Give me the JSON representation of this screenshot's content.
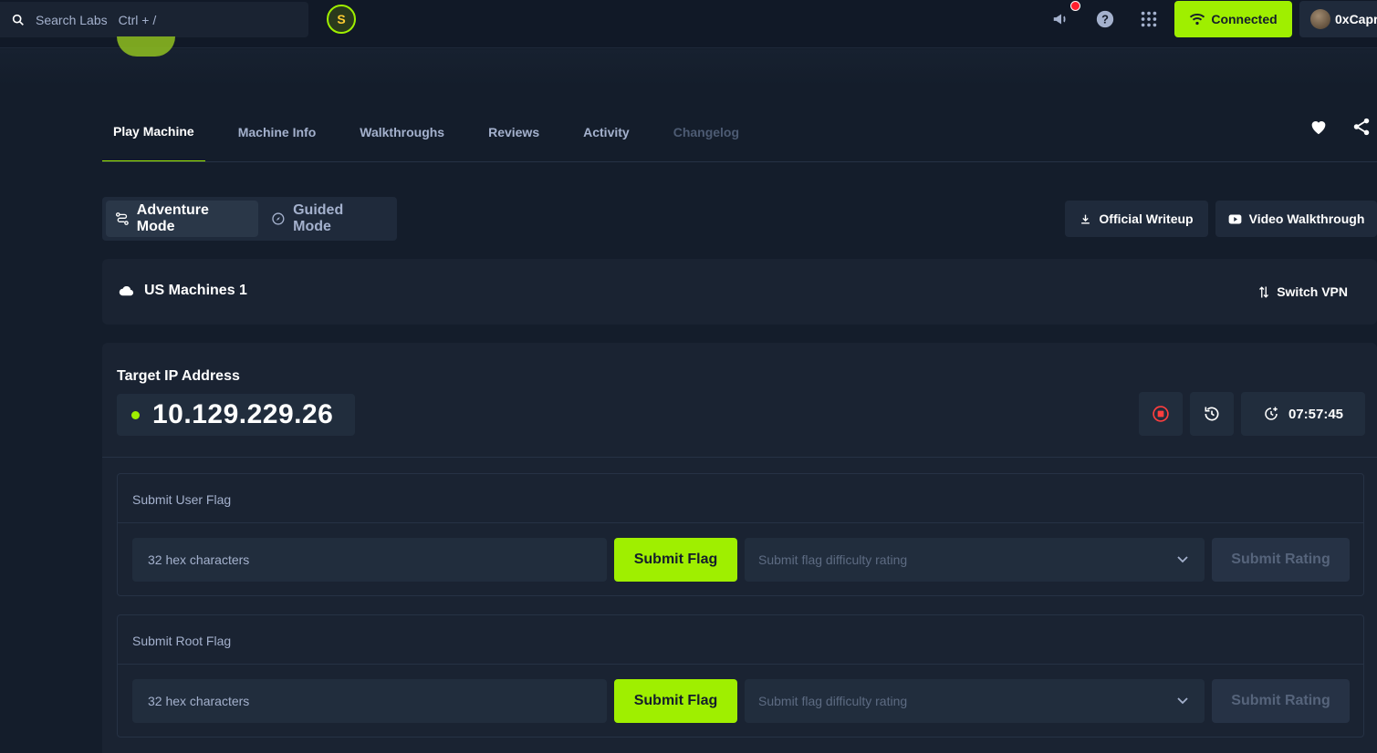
{
  "header": {
    "search_label": "Search Labs",
    "search_shortcut": "Ctrl + /",
    "connected_label": "Connected",
    "username": "0xCapr"
  },
  "tabs": [
    {
      "label": "Play Machine",
      "state": "active"
    },
    {
      "label": "Machine Info",
      "state": "normal"
    },
    {
      "label": "Walkthroughs",
      "state": "normal"
    },
    {
      "label": "Reviews",
      "state": "normal"
    },
    {
      "label": "Activity",
      "state": "normal"
    },
    {
      "label": "Changelog",
      "state": "disabled"
    }
  ],
  "modes": {
    "adventure": "Adventure Mode",
    "guided": "Guided Mode"
  },
  "actions": {
    "official_writeup": "Official Writeup",
    "video_walkthrough": "Video Walkthrough"
  },
  "vpn": {
    "server": "US Machines 1",
    "switch_label": "Switch VPN"
  },
  "target": {
    "label": "Target IP Address",
    "ip": "10.129.229.26",
    "timer": "07:57:45"
  },
  "flags": [
    {
      "title": "Submit User Flag",
      "input_placeholder": "32 hex characters",
      "submit_label": "Submit Flag",
      "rating_placeholder": "Submit flag difficulty rating",
      "rating_button": "Submit Rating"
    },
    {
      "title": "Submit Root Flag",
      "input_placeholder": "32 hex characters",
      "submit_label": "Submit Flag",
      "rating_placeholder": "Submit flag difficulty rating",
      "rating_button": "Submit Rating"
    }
  ],
  "colors": {
    "accent": "#9fef00",
    "background": "#141d2b",
    "panel": "#1a2332",
    "text_muted": "#a4b1cd",
    "stop_red": "#ff3e3e"
  }
}
